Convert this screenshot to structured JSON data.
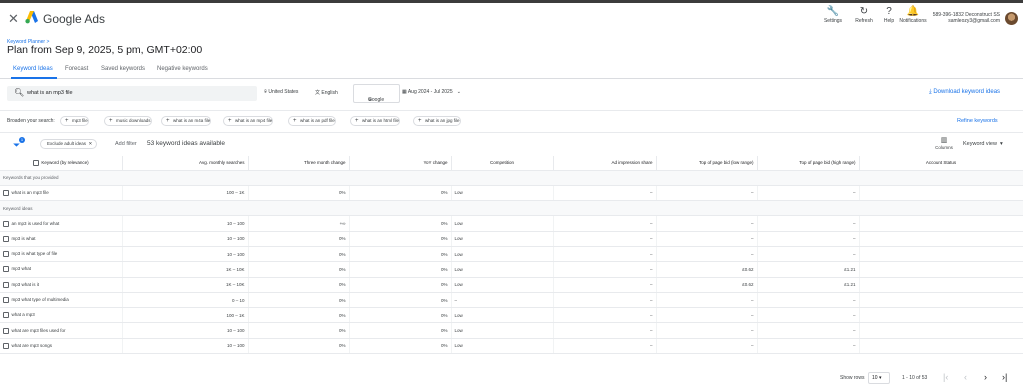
{
  "app": {
    "title": "Google Ads",
    "close_glyph": "✕"
  },
  "toolbar": {
    "items": [
      {
        "label": "Settings",
        "icon": "wrench-icon",
        "glyph": "🔧"
      },
      {
        "label": "Refresh",
        "icon": "refresh-icon",
        "glyph": "↻"
      },
      {
        "label": "Help",
        "icon": "help-icon",
        "glyph": "?"
      },
      {
        "label": "Notifications",
        "icon": "bell-icon",
        "glyph": "🔔"
      }
    ]
  },
  "account": {
    "id": "589-396-1832 Deconstruct SS",
    "email": "samleozy3@gmail.com"
  },
  "breadcrumb": "Keyword Planner >",
  "plan_title": "Plan from Sep 9, 2025, 5 pm, GMT+02:00",
  "tabs": [
    "Keyword Ideas",
    "Forecast",
    "Saved keywords",
    "Negative keywords"
  ],
  "search": {
    "icon": "search-icon",
    "value": "what is an mp3 file"
  },
  "filters": {
    "location": "United States",
    "language": "English",
    "network": "Google",
    "date_range": "Aug 2024 - Jul 2025"
  },
  "download_label": "Download keyword ideas",
  "broaden": {
    "label": "Broaden your search:",
    "chips": [
      "mp3 file",
      "music downloads",
      "what is an m4a file",
      "what is an mp4 file",
      "what is an pdf file",
      "what is an html file",
      "what is an jpg file"
    ],
    "refine": "Refine keywords"
  },
  "filterbar": {
    "badge": "1",
    "exclude_chip": "Exclude adult ideas",
    "add_filter": "Add filter",
    "count": "53 keyword ideas available",
    "columns": "Columns",
    "view": "Keyword view"
  },
  "table": {
    "columns": [
      "Keyword (by relevance)",
      "Avg. monthly searches",
      "Three month change",
      "YoY change",
      "Competition",
      "Ad impression share",
      "Top of page bid (low range)",
      "Top of page bid (high range)",
      "Account Status"
    ],
    "section_provided": "Keywords that you provided",
    "provided": [
      {
        "kw": "what is an mp3 file",
        "avg": "100 – 1K",
        "three": "0%",
        "yoy": "0%",
        "comp": "Low",
        "ais": "–",
        "low": "–",
        "high": "–"
      }
    ],
    "section_ideas": "Keyword ideas",
    "ideas": [
      {
        "kw": "an mp3 is used for what",
        "avg": "10 – 100",
        "three": "+∞",
        "yoy": "0%",
        "comp": "Low",
        "ais": "–",
        "low": "–",
        "high": "–"
      },
      {
        "kw": "mp3 is what",
        "avg": "10 – 100",
        "three": "0%",
        "yoy": "0%",
        "comp": "Low",
        "ais": "–",
        "low": "–",
        "high": "–"
      },
      {
        "kw": "mp3 is what type of file",
        "avg": "10 – 100",
        "three": "0%",
        "yoy": "0%",
        "comp": "Low",
        "ais": "–",
        "low": "–",
        "high": "–"
      },
      {
        "kw": "mp3 what",
        "avg": "1K – 10K",
        "three": "0%",
        "yoy": "0%",
        "comp": "Low",
        "ais": "–",
        "low": "£0.62",
        "high": "£1.21"
      },
      {
        "kw": "mp3 what is it",
        "avg": "1K – 10K",
        "three": "0%",
        "yoy": "0%",
        "comp": "Low",
        "ais": "–",
        "low": "£0.62",
        "high": "£1.21"
      },
      {
        "kw": "mp3 what type of multimedia",
        "avg": "0 – 10",
        "three": "0%",
        "yoy": "0%",
        "comp": "–",
        "ais": "–",
        "low": "–",
        "high": "–"
      },
      {
        "kw": "what a mp3",
        "avg": "100 – 1K",
        "three": "0%",
        "yoy": "0%",
        "comp": "Low",
        "ais": "–",
        "low": "–",
        "high": "–"
      },
      {
        "kw": "what are mp3 files used for",
        "avg": "10 – 100",
        "three": "0%",
        "yoy": "0%",
        "comp": "Low",
        "ais": "–",
        "low": "–",
        "high": "–"
      },
      {
        "kw": "what are mp3 songs",
        "avg": "10 – 100",
        "three": "0%",
        "yoy": "0%",
        "comp": "Low",
        "ais": "–",
        "low": "–",
        "high": "–"
      }
    ]
  },
  "pagination": {
    "label": "Show rows",
    "rows": "10",
    "range": "1 - 10 of 53"
  }
}
